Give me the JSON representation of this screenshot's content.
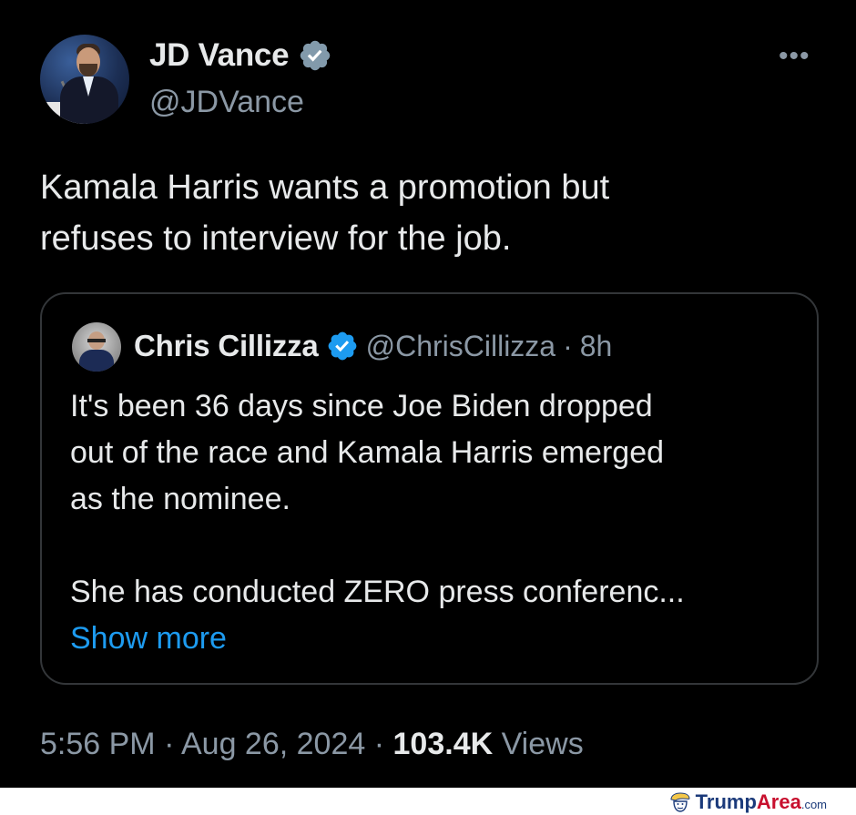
{
  "author": {
    "display_name": "JD Vance",
    "handle": "@JDVance",
    "verified_icon": "verified-badge-icon"
  },
  "tweet": {
    "text_line1": "Kamala Harris wants a promotion but",
    "text_line2": "refuses to interview for the job."
  },
  "quote": {
    "display_name": "Chris Cillizza",
    "handle": "@ChrisCillizza",
    "separator": "·",
    "time": "8h",
    "para1_line1": "It's been 36 days since Joe Biden dropped",
    "para1_line2": "out of the race and Kamala Harris emerged",
    "para1_line3": "as the nominee.",
    "para2_line1": "She has conducted ZERO press conferenc...",
    "show_more": "Show more"
  },
  "meta": {
    "time": "5:56 PM",
    "sep1": "·",
    "date": "Aug 26, 2024",
    "sep2": "·",
    "views_count": "103.4K",
    "views_label": "Views"
  },
  "watermark": {
    "part1": "Trump",
    "part2": "Area",
    "part3": ".com"
  },
  "colors": {
    "background": "#000000",
    "text_primary": "#e7e9ea",
    "text_secondary": "#8b98a5",
    "link": "#1d9bf0",
    "border": "#333639",
    "verified_blue": "#1d9bf0",
    "verified_gray": "#829aab"
  }
}
